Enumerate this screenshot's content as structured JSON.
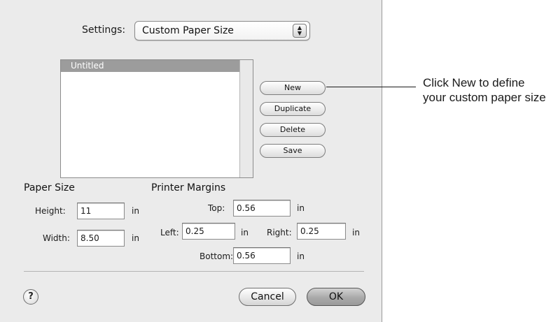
{
  "settings": {
    "label": "Settings:",
    "selected": "Custom Paper Size",
    "arrows_glyph": "▲▼"
  },
  "list": {
    "items": [
      "Untitled"
    ]
  },
  "buttons": {
    "new": "New",
    "duplicate": "Duplicate",
    "delete": "Delete",
    "save": "Save",
    "cancel": "Cancel",
    "ok": "OK",
    "help": "?"
  },
  "paper_size": {
    "heading": "Paper Size",
    "height_label": "Height:",
    "height_value": "11",
    "width_label": "Width:",
    "width_value": "8.50",
    "unit": "in"
  },
  "printer_margins": {
    "heading": "Printer Margins",
    "top_label": "Top:",
    "top_value": "0.56",
    "left_label": "Left:",
    "left_value": "0.25",
    "right_label": "Right:",
    "right_value": "0.25",
    "bottom_label": "Bottom:",
    "bottom_value": "0.56",
    "unit": "in"
  },
  "callout": {
    "text": "Click New to define your custom paper size"
  },
  "colors": {
    "dialog_bg": "#ebebeb",
    "selection": "#9c9c9c",
    "ok_button": "#a9a9a9"
  }
}
